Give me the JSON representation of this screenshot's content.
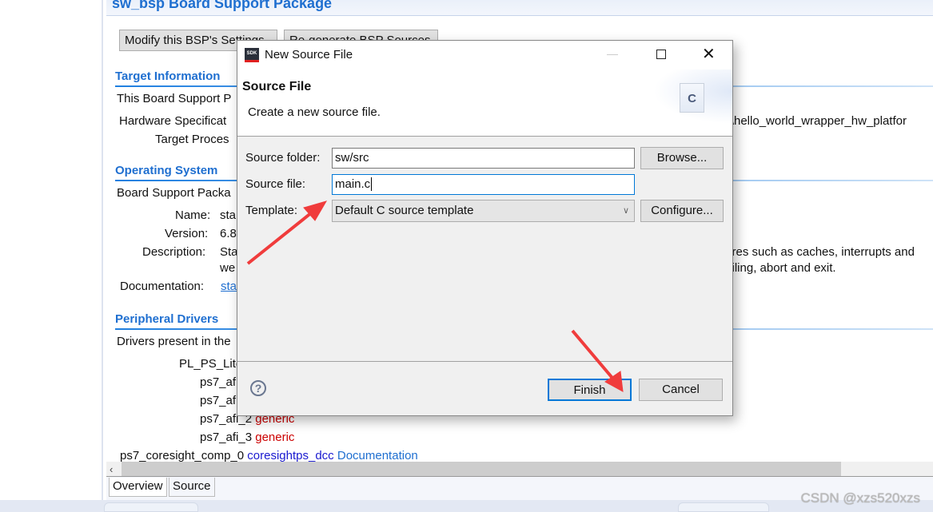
{
  "editor": {
    "title": "sw_bsp Board Support Package",
    "buttons": {
      "modify": "Modify this BSP's Settings",
      "regen": "Re-generate BSP Sources"
    },
    "target_info": {
      "heading": "Target Information",
      "line1": "This Board Support P",
      "hw_spec_label": "Hardware Specificat",
      "hw_spec_value": "lk\\hello_world_wrapper_hw_platfor",
      "target_proc_label": "Target Proces"
    },
    "os": {
      "heading": "Operating System",
      "line1": "Board Support Packa",
      "name_label": "Name:",
      "name_value": "sta",
      "version_label": "Version:",
      "version_value": "6.8",
      "desc_label": "Description:",
      "desc_value1": "Sta",
      "desc_value2": "we",
      "desc_right1": "tures such as caches, interrupts and",
      "desc_right2": "ofiling, abort and exit.",
      "doc_label": "Documentation:",
      "doc_value": "sta"
    },
    "drivers": {
      "heading": "Peripheral Drivers",
      "line1": "Drivers present in the",
      "group": "PL_PS_Lite",
      "items": [
        {
          "name": "ps7_af",
          "driver": ""
        },
        {
          "name": "ps7_af",
          "driver": ""
        },
        {
          "name": "ps7_afi_2",
          "driver": "generic"
        },
        {
          "name": "ps7_afi_3",
          "driver": "generic"
        }
      ],
      "coresight": {
        "name": "ps7_coresight_comp_0",
        "driver": "coresightps_dcc",
        "doc": "Documentation"
      }
    },
    "tabs": [
      "Overview",
      "Source"
    ]
  },
  "dialog": {
    "title": "New Source File",
    "app_icon": "SDK",
    "heading": "Source File",
    "description": "Create a new source file.",
    "fields": {
      "folder": {
        "label": "Source folder:",
        "value": "sw/src"
      },
      "file": {
        "label": "Source file:",
        "value": "main.c"
      },
      "template": {
        "label": "Template:",
        "value": "Default C source template"
      }
    },
    "buttons": {
      "browse": "Browse...",
      "configure": "Configure...",
      "finish": "Finish",
      "cancel": "Cancel"
    }
  },
  "annotation_color": "#f03c3c",
  "watermark": "CSDN @xzs520xzs"
}
